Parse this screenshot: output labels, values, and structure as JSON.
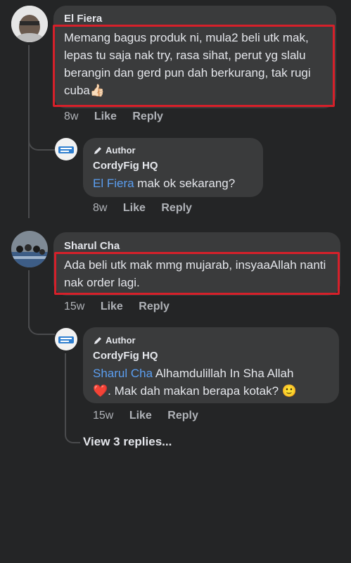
{
  "comments": [
    {
      "author": "El Fiera",
      "text": "Memang bagus produk ni, mula2 beli utk mak, lepas tu saja nak try, rasa sihat, perut yg slalu berangin dan gerd pun dah berkurang, tak rugi cuba👍🏻",
      "time": "8w",
      "like_label": "Like",
      "reply_label": "Reply",
      "reply": {
        "badge": "Author",
        "author": "CordyFig HQ",
        "mention": "El Fiera",
        "text": " mak ok sekarang?",
        "time": "8w",
        "like_label": "Like",
        "reply_label": "Reply"
      }
    },
    {
      "author": "Sharul Cha",
      "text": "Ada beli utk mak mmg mujarab, insyaaAllah nanti nak order lagi.",
      "time": "15w",
      "like_label": "Like",
      "reply_label": "Reply",
      "reply": {
        "badge": "Author",
        "author": "CordyFig HQ",
        "mention": "Sharul Cha",
        "text_line1": " Alhamdulillah In Sha Allah",
        "text_line2": "❤️. Mak dah makan berapa kotak? 🙂",
        "time": "15w",
        "like_label": "Like",
        "reply_label": "Reply"
      },
      "view_replies": "View 3 replies..."
    }
  ],
  "colors": {
    "background": "#242526",
    "bubble": "#3a3b3c",
    "mention": "#5b9ef0",
    "highlight": "#d6202a"
  }
}
